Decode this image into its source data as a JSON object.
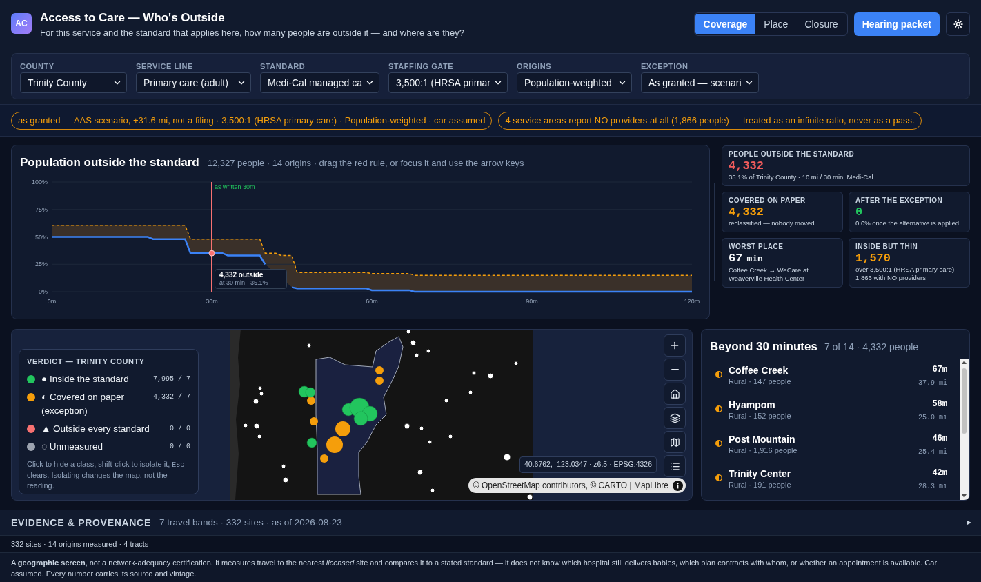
{
  "header": {
    "logo": "AC",
    "title": "Access to Care — Who's Outside",
    "subtitle": "For this service and the standard that applies here, how many people are outside it — and where are they?",
    "tabs": [
      {
        "label": "Coverage",
        "selected": true
      },
      {
        "label": "Place",
        "selected": false
      },
      {
        "label": "Closure",
        "selected": false
      }
    ],
    "primary_action": "Hearing packet"
  },
  "filters": [
    {
      "label": "COUNTY",
      "value": "Trinity County"
    },
    {
      "label": "SERVICE LINE",
      "value": "Primary care (adult)"
    },
    {
      "label": "STANDARD",
      "value": "Medi-Cal managed ca"
    },
    {
      "label": "STAFFING GATE",
      "value": "3,500:1 (HRSA primar"
    },
    {
      "label": "ORIGINS",
      "value": "Population-weighted"
    },
    {
      "label": "EXCEPTION",
      "value": "As granted — scenari"
    }
  ],
  "notices": [
    "as granted — AAS scenario, +31.6 mi, not a filing · 3,500:1 (HRSA primary care) · Population-weighted · car assumed",
    "4 service areas report NO providers at all (1,866 people) — treated as an infinite ratio, never as a pass."
  ],
  "chart": {
    "title": "Population outside the standard",
    "subtitle": "12,327 people · 14 origins · drag the red rule, or focus it and use the arrow keys",
    "tooltip": {
      "title": "4,332 outside",
      "detail": "at 30 min · 35.1%"
    },
    "chart_data": {
      "type": "line",
      "x": [
        0,
        18,
        19,
        25,
        26,
        32,
        33,
        39,
        40,
        42,
        43,
        45,
        46,
        59,
        60,
        67,
        68,
        120
      ],
      "series": [
        {
          "color": "#3b82f6",
          "line_style": "solid",
          "values": [
            50,
            50,
            48,
            48,
            35.1,
            35.1,
            33,
            33,
            25,
            null,
            null,
            4,
            3,
            3,
            1.3,
            1.3,
            0,
            0
          ]
        },
        {
          "color": "#f59e0b",
          "line_style": "dashed",
          "values": [
            60.5,
            60.5,
            60.5,
            60.5,
            48,
            48,
            48,
            48,
            35,
            35,
            33,
            33,
            17.5,
            17.5,
            16.5,
            16.5,
            15,
            15
          ]
        }
      ],
      "xlim": [
        0,
        120
      ],
      "ylim": [
        0,
        100
      ],
      "xticks": [
        {
          "value": 0,
          "label": "0m"
        },
        {
          "value": 30,
          "label": "30m"
        },
        {
          "value": 60,
          "label": "60m"
        },
        {
          "value": 90,
          "label": "90m"
        },
        {
          "value": 120,
          "label": "120m"
        }
      ],
      "yticks": [
        {
          "value": 0,
          "label": "0%"
        },
        {
          "value": 25,
          "label": "25%"
        },
        {
          "value": 50,
          "label": "50%"
        },
        {
          "value": 75,
          "label": "75%"
        },
        {
          "value": 100,
          "label": "100%"
        }
      ],
      "grid": true,
      "ref_lines": [
        {
          "axis": "x",
          "value": 30,
          "label": "as written 30m",
          "color": "#f87171"
        }
      ]
    }
  },
  "headline": {
    "label": "PEOPLE OUTSIDE THE STANDARD",
    "value": "4,332",
    "detail": "35.1% of Trinity County · 10 mi / 30 min, Medi-Cal",
    "color": "#f25c5c"
  },
  "stats": [
    {
      "label": "COVERED ON PAPER",
      "value": "4,332",
      "detail": "reclassified — nobody moved",
      "color": "#f59e0b"
    },
    {
      "label": "AFTER THE EXCEPTION",
      "value": "0",
      "detail": "0.0% once the alternative is applied",
      "color": "#22c55e"
    },
    {
      "label": "WORST PLACE",
      "value": "67",
      "unit": "min",
      "detail": "Coffee Creek → WeCare at Weaverville Health Center",
      "color": "#f8fafc"
    },
    {
      "label": "INSIDE BUT THIN",
      "value": "1,570",
      "detail": "over 3,500:1 (HRSA primary care) · 1,866 with NO providers",
      "color": "#f59e0b"
    }
  ],
  "legend": {
    "title": "VERDICT — TRINITY COUNTY",
    "items": [
      {
        "label": "● Inside the standard",
        "count": "7,995 / 7",
        "color": "#22c55e"
      },
      {
        "label": "◐ Covered on paper (exception)",
        "count": "4,332 / 7",
        "color": "#f59e0b"
      },
      {
        "label": "▲ Outside every standard",
        "count": "0 / 0",
        "color": "#f87171"
      },
      {
        "label": "◌ Unmeasured",
        "count": "0 / 0",
        "color": "#9ca3af"
      }
    ],
    "hint": {
      "before": "Click to hide a class, shift-click to isolate it, ",
      "key": "Esc",
      "after": " clears. Isolating changes the map, not the reading."
    }
  },
  "map": {
    "coordinates": "40.6762, -123.0347 · z6.5 · EPSG:4326",
    "attribution": "© OpenStreetMap contributors, © CARTO | MapLibre"
  },
  "beyond": {
    "title": "Beyond 30 minutes",
    "summary": "7 of 14 · 4,332 people",
    "rows": [
      {
        "name": "Coffee Creek",
        "detail": "Rural · 147 people",
        "time": "67m",
        "distance": "37.9 mi"
      },
      {
        "name": "Hyampom",
        "detail": "Rural · 152 people",
        "time": "58m",
        "distance": "25.0 mi"
      },
      {
        "name": "Post Mountain",
        "detail": "Rural · 1,916 people",
        "time": "46m",
        "distance": "25.4 mi"
      },
      {
        "name": "Trinity Center",
        "detail": "Rural · 191 people",
        "time": "42m",
        "distance": "28.3 mi"
      }
    ]
  },
  "evidence": {
    "title": "EVIDENCE & PROVENANCE",
    "summary": "7 travel bands · 332 sites · as of 2026-08-23",
    "expanded": false
  },
  "coverage_note": "332 sites · 14 origins measured · 4 tracts",
  "disclaimer": "A **geographic screen**, not a network-adequacy certification. It measures travel to the nearest *licensed* site and compares it to a stated standard — it does not know which hospital still delivers babies, which plan contracts with whom, or whether an appointment is available. Car assumed. Every number carries its source and vintage."
}
